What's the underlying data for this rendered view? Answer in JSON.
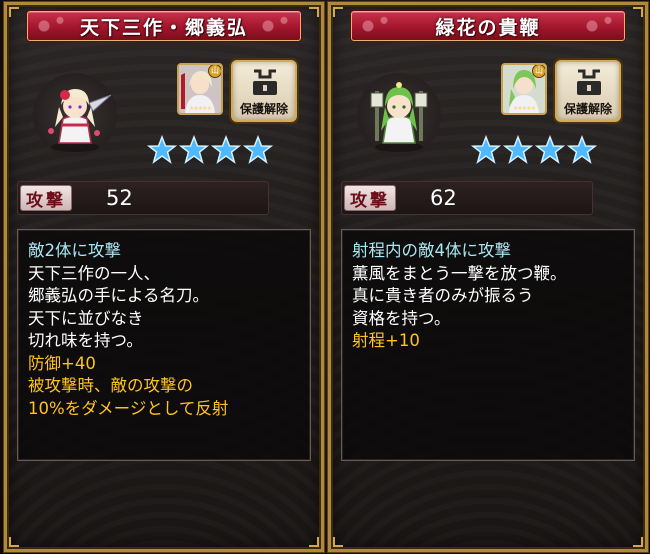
{
  "cards": [
    {
      "title": "天下三作・郷義弘",
      "release_button_label": "保護解除",
      "star_count": 4,
      "stat_label": "攻撃",
      "stat_value": "52",
      "lines": [
        {
          "text": "敵2体に攻撃",
          "color": "cyan"
        },
        {
          "text": "天下三作の一人、",
          "color": "white"
        },
        {
          "text": "郷義弘の手による名刀。",
          "color": "white"
        },
        {
          "text": "天下に並びなき",
          "color": "white"
        },
        {
          "text": "切れ味を持つ。",
          "color": "white"
        },
        {
          "text": "防御+40",
          "color": "yellow"
        },
        {
          "text": "被攻撃時、敵の攻撃の",
          "color": "yellow"
        },
        {
          "text": "10%をダメージとして反射",
          "color": "yellow"
        }
      ]
    },
    {
      "title": "緑花の貴鞭",
      "release_button_label": "保護解除",
      "star_count": 4,
      "stat_label": "攻撃",
      "stat_value": "62",
      "lines": [
        {
          "text": "射程内の敵4体に攻撃",
          "color": "cyan"
        },
        {
          "text": "薫風をまとう一撃を放つ鞭。",
          "color": "white"
        },
        {
          "text": "真に貴き者のみが振るう",
          "color": "white"
        },
        {
          "text": "資格を持つ。",
          "color": "white"
        },
        {
          "text": "射程+10",
          "color": "yellow"
        }
      ]
    }
  ],
  "colors": {
    "title_red": "#a3162c",
    "frame_gold": "#b08a3a",
    "star_blue": "#4fb8ff",
    "text_cyan": "#a9e7f3",
    "text_yellow": "#ffc31f"
  }
}
